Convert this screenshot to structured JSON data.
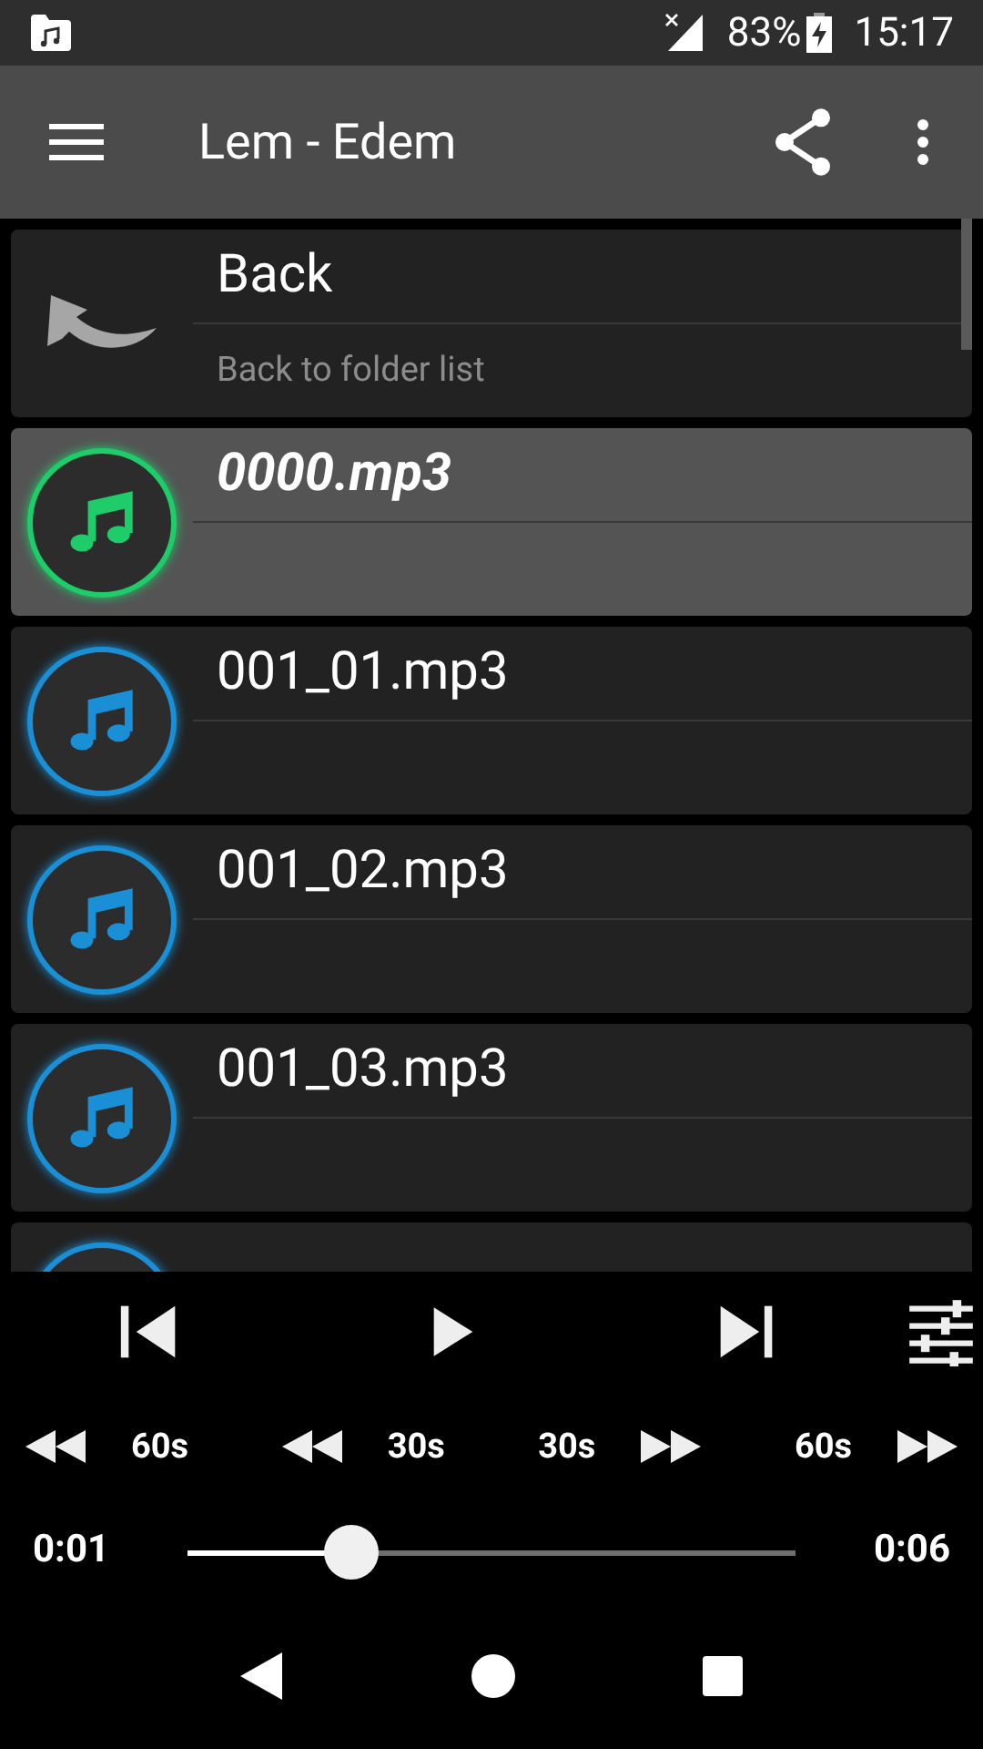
{
  "status_bar": {
    "battery": "83%",
    "time": "15:17"
  },
  "toolbar": {
    "title": "Lem - Edem"
  },
  "list": [
    {
      "kind": "back",
      "title": "Back",
      "subtitle": "Back to folder list",
      "selected": false
    },
    {
      "kind": "track",
      "title": "0000.mp3",
      "selected": true
    },
    {
      "kind": "track",
      "title": "001_01.mp3",
      "selected": false
    },
    {
      "kind": "track",
      "title": "001_02.mp3",
      "selected": false
    },
    {
      "kind": "track",
      "title": "001_03.mp3",
      "selected": false
    },
    {
      "kind": "track",
      "selected": false
    }
  ],
  "seek_buttons": [
    {
      "kind": "back",
      "label": "60s"
    },
    {
      "kind": "back",
      "label": "30s"
    },
    {
      "kind": "forward",
      "label": "30s"
    },
    {
      "kind": "forward",
      "label": "60s"
    }
  ],
  "progress": {
    "elapsed": "0:01",
    "total": "0:06",
    "level": 0.27
  }
}
